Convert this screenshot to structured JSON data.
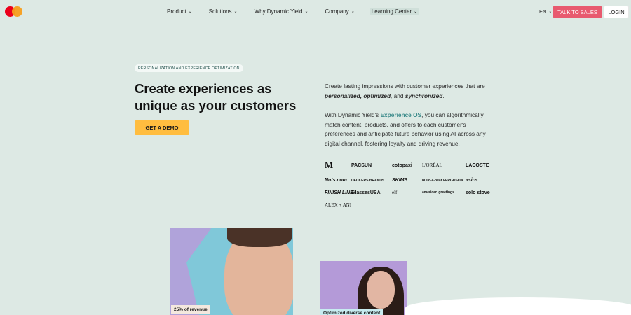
{
  "nav": {
    "items": [
      {
        "label": "Product"
      },
      {
        "label": "Solutions"
      },
      {
        "label": "Why Dynamic Yield"
      },
      {
        "label": "Company"
      },
      {
        "label": "Learning Center"
      }
    ],
    "lang": "EN",
    "talk_label": "TALK TO SALES",
    "login_label": "LOGIN"
  },
  "hero": {
    "eyebrow": "PERSONALIZATION AND EXPERIENCE OPTIMIZATION",
    "headline": "Create experiences as unique as your customers",
    "cta": "GET A DEMO",
    "p1_pre": "Create lasting impressions with customer experiences that are ",
    "p1_b1": "personalized, optimized,",
    "p1_mid": " and ",
    "p1_b2": "synchronized",
    "p1_end": ".",
    "p2_pre": "With Dynamic Yield's ",
    "p2_link": "Experience OS",
    "p2_post": ", you can algorithmically match content, products, and offers to each customer's preferences and anticipate future behavior using AI across any digital channel, fostering loyalty and driving revenue."
  },
  "logos": [
    "M",
    "PACSUN",
    "cotopaxi",
    "L'ORÉAL",
    "LACOSTE",
    "Nuts.com",
    "DECKERS BRANDS",
    "SKIMS",
    "build-a-bear FERGUSON",
    "asics",
    "FINISH LINE",
    "GlassesUSA",
    "elf",
    "american greetings",
    "solo stove",
    "ALEX + ANI"
  ],
  "cards": {
    "badge1": "25% of revenue",
    "badge2": "Optimized diverse content"
  },
  "colors": {
    "bg": "#dde9e4",
    "talk_button": "#e85a6f",
    "demo_button": "#ffbd3f",
    "link": "#3b8a8a"
  }
}
